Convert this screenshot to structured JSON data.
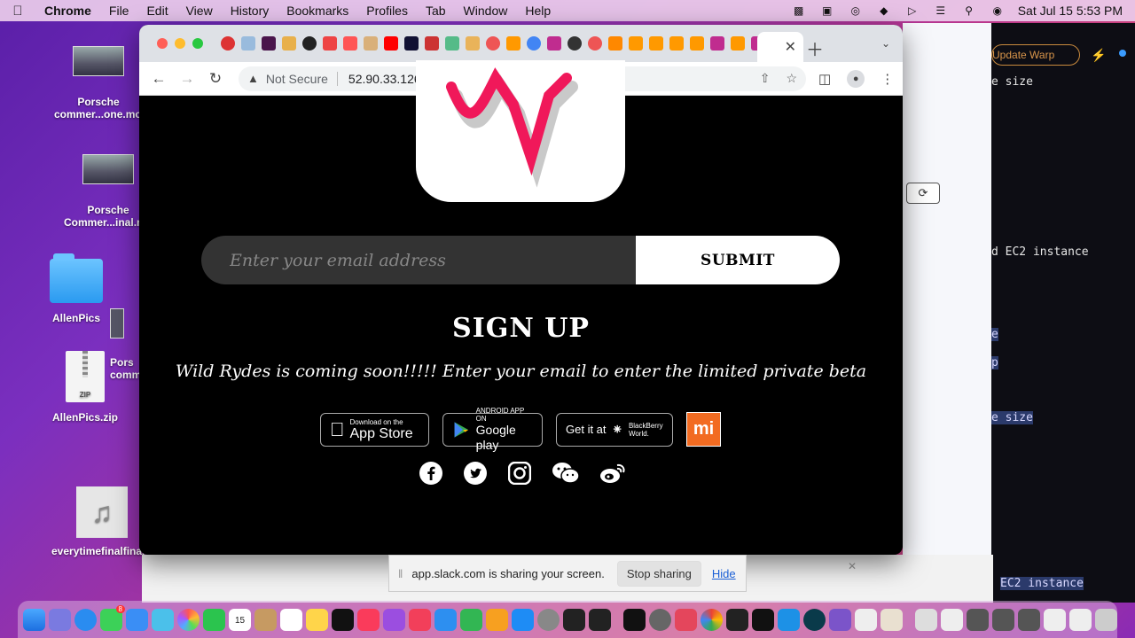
{
  "menubar": {
    "app_name": "Chrome",
    "items": [
      "File",
      "Edit",
      "View",
      "History",
      "Bookmarks",
      "Profiles",
      "Tab",
      "Window",
      "Help"
    ],
    "clock": "Sat Jul 15  5:53 PM"
  },
  "desktop": {
    "icons": [
      {
        "label": "Porsche commer...one.mov"
      },
      {
        "label": "Porsche Commer...inal.mov"
      },
      {
        "label": "AllenPics"
      },
      {
        "label": "AllenPics.zip"
      },
      {
        "label": "everytimefinalfinal.wav"
      },
      {
        "label": "Pors comm"
      }
    ],
    "zip_tag": "ZIP"
  },
  "background_window": {
    "warp_button": "Update Warp",
    "lines": [
      "e size",
      "d EC2 instance",
      "e",
      "p",
      "e size",
      "EC2 instance"
    ]
  },
  "browser": {
    "not_secure": "Not Secure",
    "url": "52.90.33.126"
  },
  "page": {
    "email_placeholder": "Enter your email address",
    "submit_label": "SUBMIT",
    "signup_title": "SIGN UP",
    "tagline": "Wild Rydes is coming soon!!!!! Enter your email to enter the limited private beta",
    "stores": {
      "appstore_small": "Download on the",
      "appstore_big": "App Store",
      "google_small": "ANDROID APP ON",
      "google_big": "Google play",
      "bb_get": "Get it at",
      "bb_name_1": "BlackBerry",
      "bb_name_2": "World.",
      "mi": "mi"
    }
  },
  "share_bar": {
    "message": "app.slack.com is sharing your screen.",
    "stop_label": "Stop sharing",
    "hide_label": "Hide"
  },
  "dock": {
    "badge_messages": "8",
    "calendar_day": "15"
  }
}
